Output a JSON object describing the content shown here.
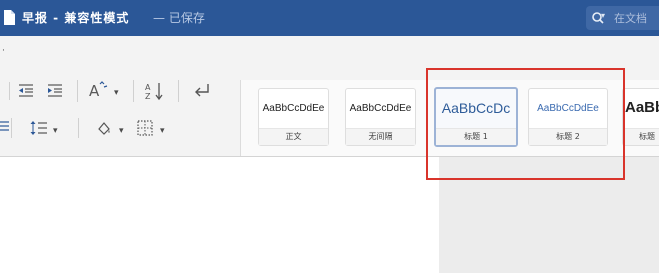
{
  "window": {
    "title": "早报 - 兼容性模式",
    "status": "— 已保存"
  },
  "search": {
    "placeholder": "在文档"
  },
  "styles": [
    {
      "preview": "AaBbCcDdEe",
      "name": "正文"
    },
    {
      "preview": "AaBbCcDdEe",
      "name": "无间隔"
    },
    {
      "preview": "AaBbCcDc",
      "name": "标题 1"
    },
    {
      "preview": "AaBbCcDdEe",
      "name": "标题 2"
    },
    {
      "preview": "AaBb",
      "name": "标题"
    }
  ],
  "highlight": {
    "color": "#d9342b"
  },
  "icons": {
    "toolbar": [
      "decrease-indent-icon",
      "increase-indent-icon",
      "text-effects-icon",
      "sort-icon",
      "paragraph-mark-icon",
      "line-spacing-icon",
      "shading-icon",
      "borders-icon"
    ]
  }
}
